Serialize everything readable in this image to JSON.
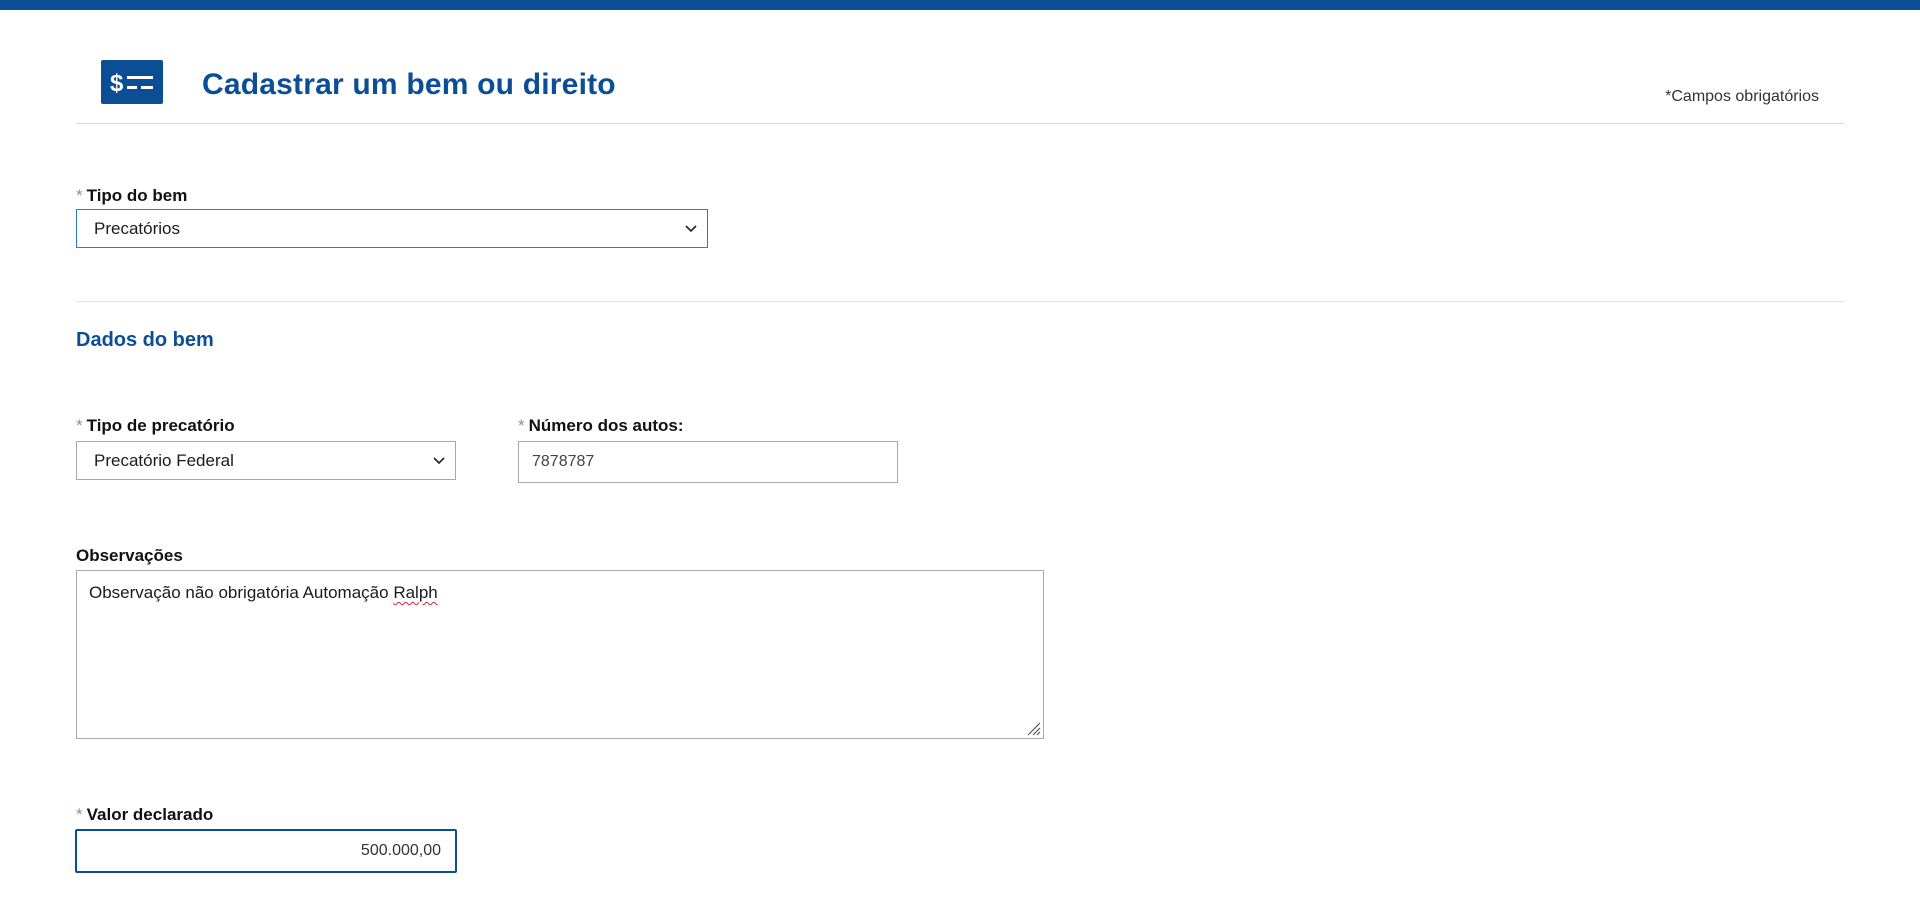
{
  "header": {
    "title": "Cadastrar um bem ou direito",
    "icon": "dollar-bill-icon",
    "required_note": "*Campos obrigatórios"
  },
  "colors": {
    "brand": "#0b4e96",
    "required_star": "#7f93a8"
  },
  "tipo_bem": {
    "required_mark": "*",
    "label": "Tipo do bem",
    "value": "Precatórios"
  },
  "section": {
    "title": "Dados do bem"
  },
  "tipo_precatorio": {
    "required_mark": "*",
    "label": "Tipo de precatório",
    "value": "Precatório Federal"
  },
  "numero_autos": {
    "required_mark": "*",
    "label": "Número dos autos:",
    "value": "7878787"
  },
  "observacoes": {
    "label": "Observações",
    "value_main": "Observação não obrigatória Automação ",
    "value_flagged": "Ralph"
  },
  "valor_declarado": {
    "required_mark": "*",
    "label": "Valor declarado",
    "value": "500.000,00"
  }
}
